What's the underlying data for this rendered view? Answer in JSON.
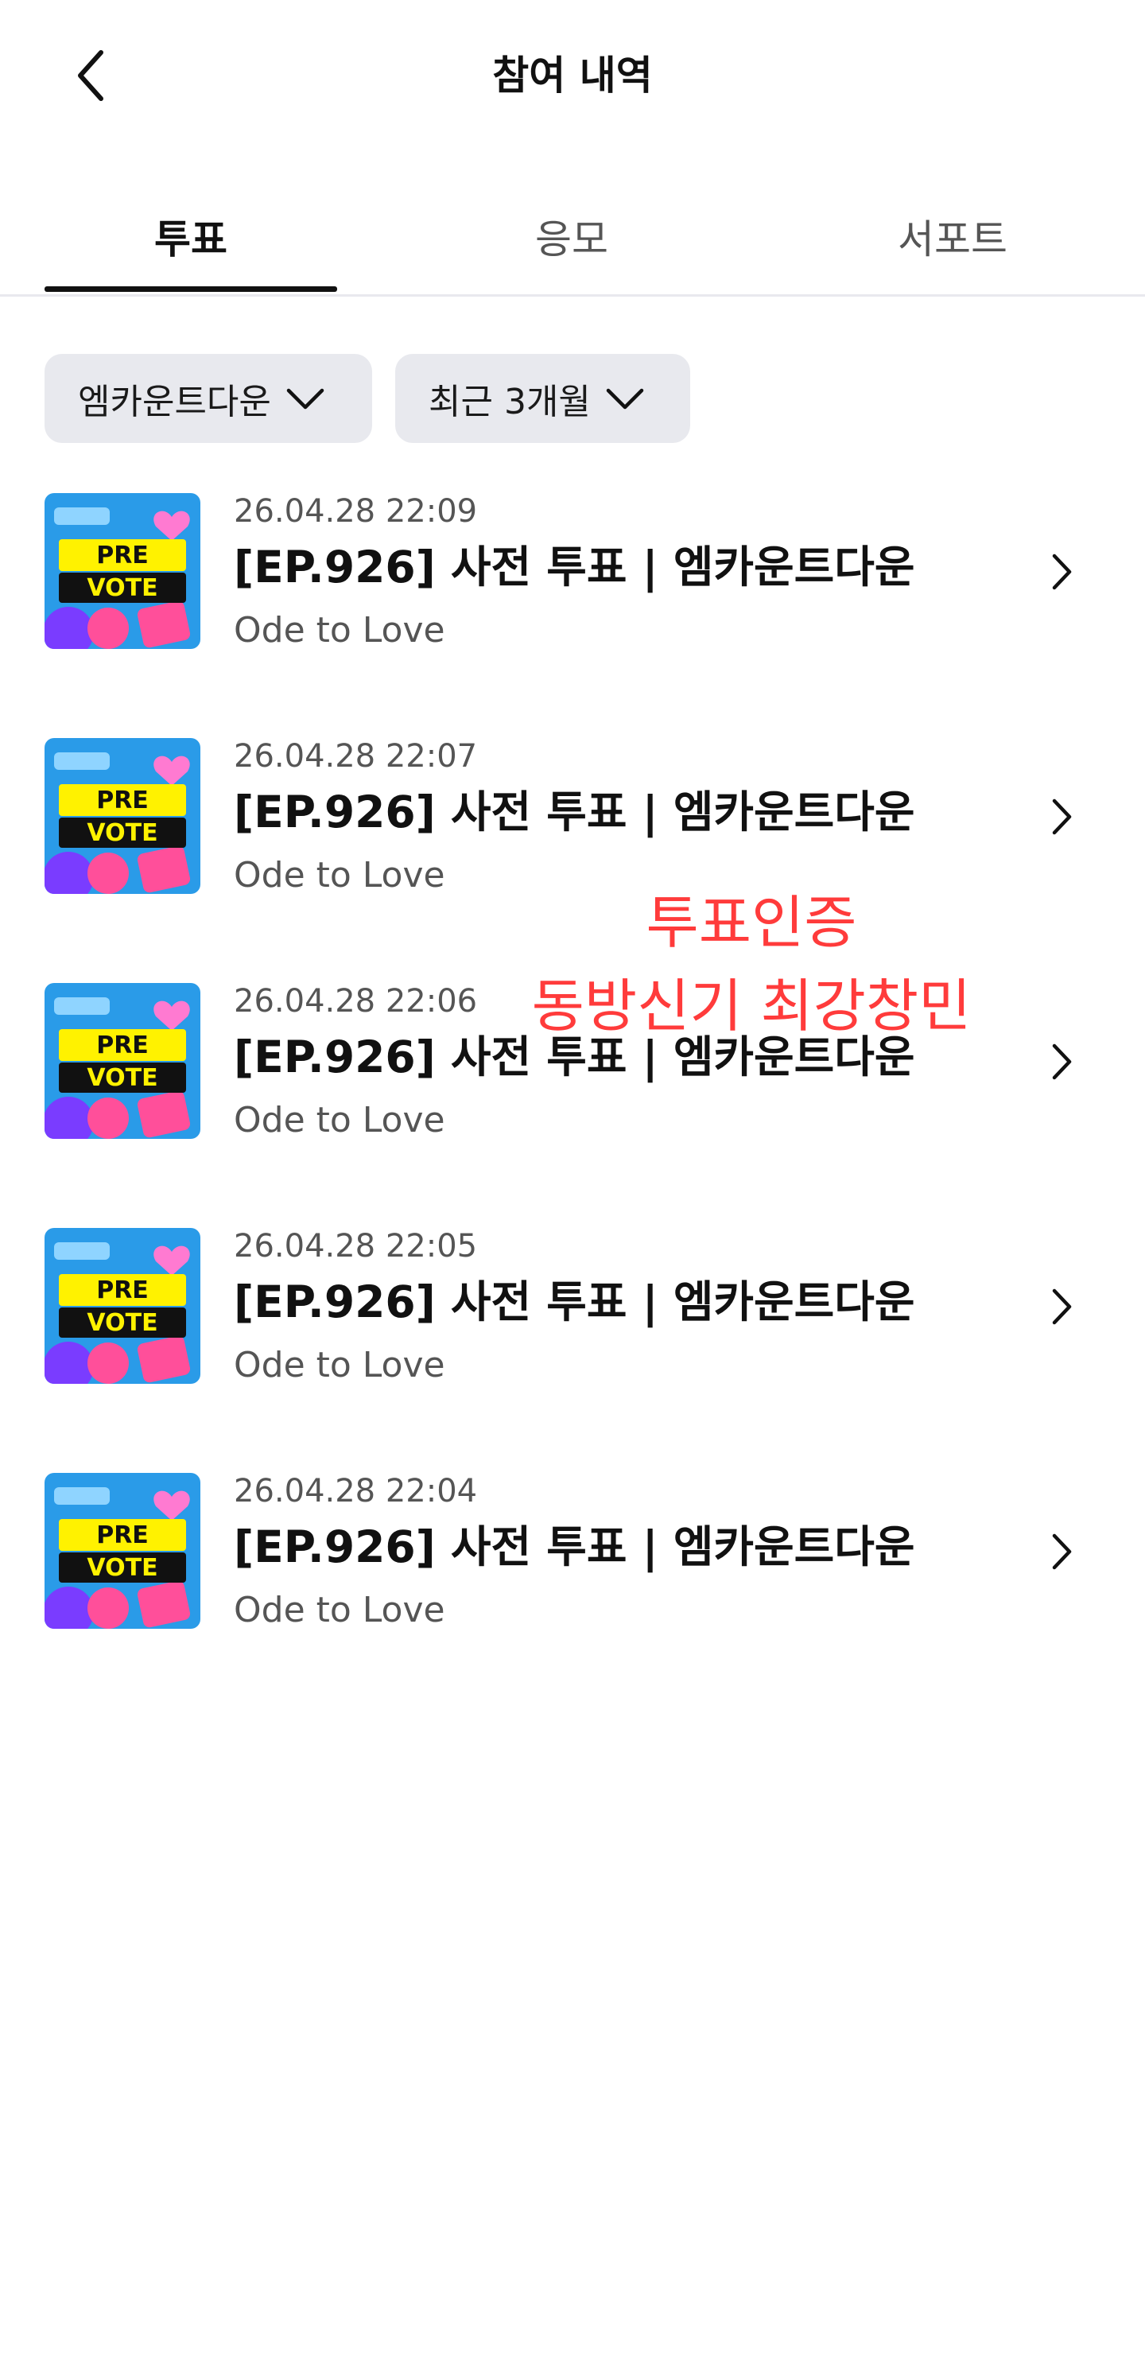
{
  "header": {
    "back_icon": "chevron-left-icon",
    "title": "참여 내역"
  },
  "tabs": [
    {
      "label": "투표",
      "active": true
    },
    {
      "label": "응모",
      "active": false
    },
    {
      "label": "서포트",
      "active": false
    }
  ],
  "filters": [
    {
      "label": "엠카운트다운",
      "icon": "chevron-down-icon"
    },
    {
      "label": "최근 3개월",
      "icon": "chevron-down-icon"
    }
  ],
  "items": [
    {
      "date": "26.04.28 22:09",
      "title": "[EP.926] 사전 투표 | 엠카운트다운",
      "subtitle": "Ode to Love",
      "thumb_top": "PRE",
      "thumb_bottom": "VOTE"
    },
    {
      "date": "26.04.28 22:07",
      "title": "[EP.926] 사전 투표 | 엠카운트다운",
      "subtitle": "Ode to Love",
      "thumb_top": "PRE",
      "thumb_bottom": "VOTE"
    },
    {
      "date": "26.04.28 22:06",
      "title": "[EP.926] 사전 투표 | 엠카운트다운",
      "subtitle": "Ode to Love",
      "thumb_top": "PRE",
      "thumb_bottom": "VOTE"
    },
    {
      "date": "26.04.28 22:05",
      "title": "[EP.926] 사전 투표 | 엠카운트다운",
      "subtitle": "Ode to Love",
      "thumb_top": "PRE",
      "thumb_bottom": "VOTE"
    },
    {
      "date": "26.04.28 22:04",
      "title": "[EP.926] 사전 투표 | 엠카운트다운",
      "subtitle": "Ode to Love",
      "thumb_top": "PRE",
      "thumb_bottom": "VOTE"
    }
  ],
  "overlay": {
    "line1": "투표인증",
    "line2": "동방신기 최강창민",
    "color": "#ff3b3b"
  },
  "colors": {
    "accent": "#111111",
    "chip_bg": "#e8e9ee",
    "thumb_blue": "#2a9be8",
    "thumb_yellow": "#fff200",
    "thumb_pink": "#ff4f9a",
    "thumb_purple": "#7a3cff"
  }
}
